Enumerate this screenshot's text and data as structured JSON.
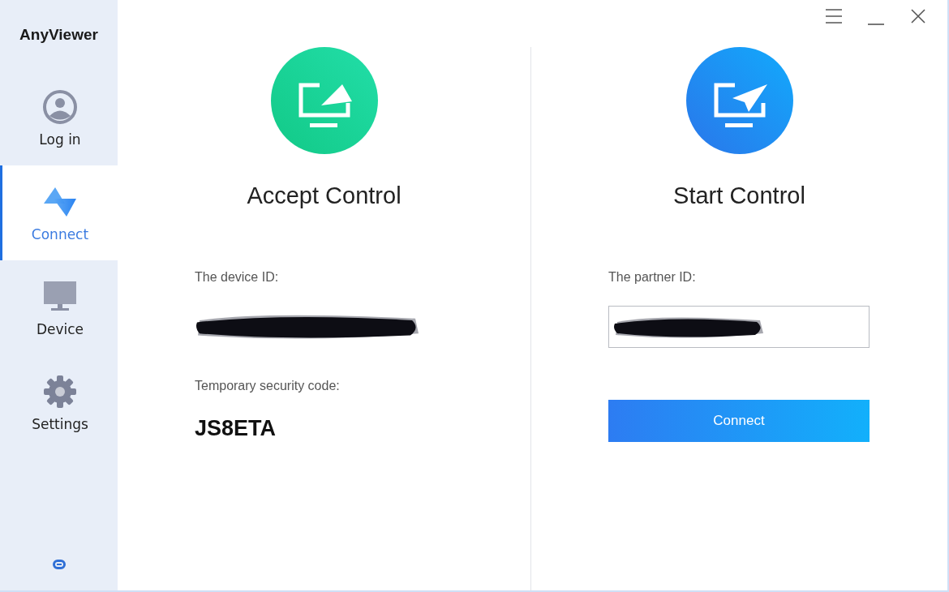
{
  "app": {
    "name": "AnyViewer"
  },
  "nav": [
    {
      "label": "Log in",
      "kind": "user",
      "selected": false
    },
    {
      "label": "Connect",
      "kind": "connect",
      "selected": true
    },
    {
      "label": "Device",
      "kind": "monitor",
      "selected": false
    },
    {
      "label": "Settings",
      "kind": "gear",
      "selected": false
    }
  ],
  "accept": {
    "title": "Accept Control",
    "device_id_label": "The device ID:",
    "security_label": "Temporary security code:",
    "security_code": "JS8ETA"
  },
  "start": {
    "title": "Start Control",
    "partner_label": "The partner ID:",
    "connect_button": "Connect"
  }
}
